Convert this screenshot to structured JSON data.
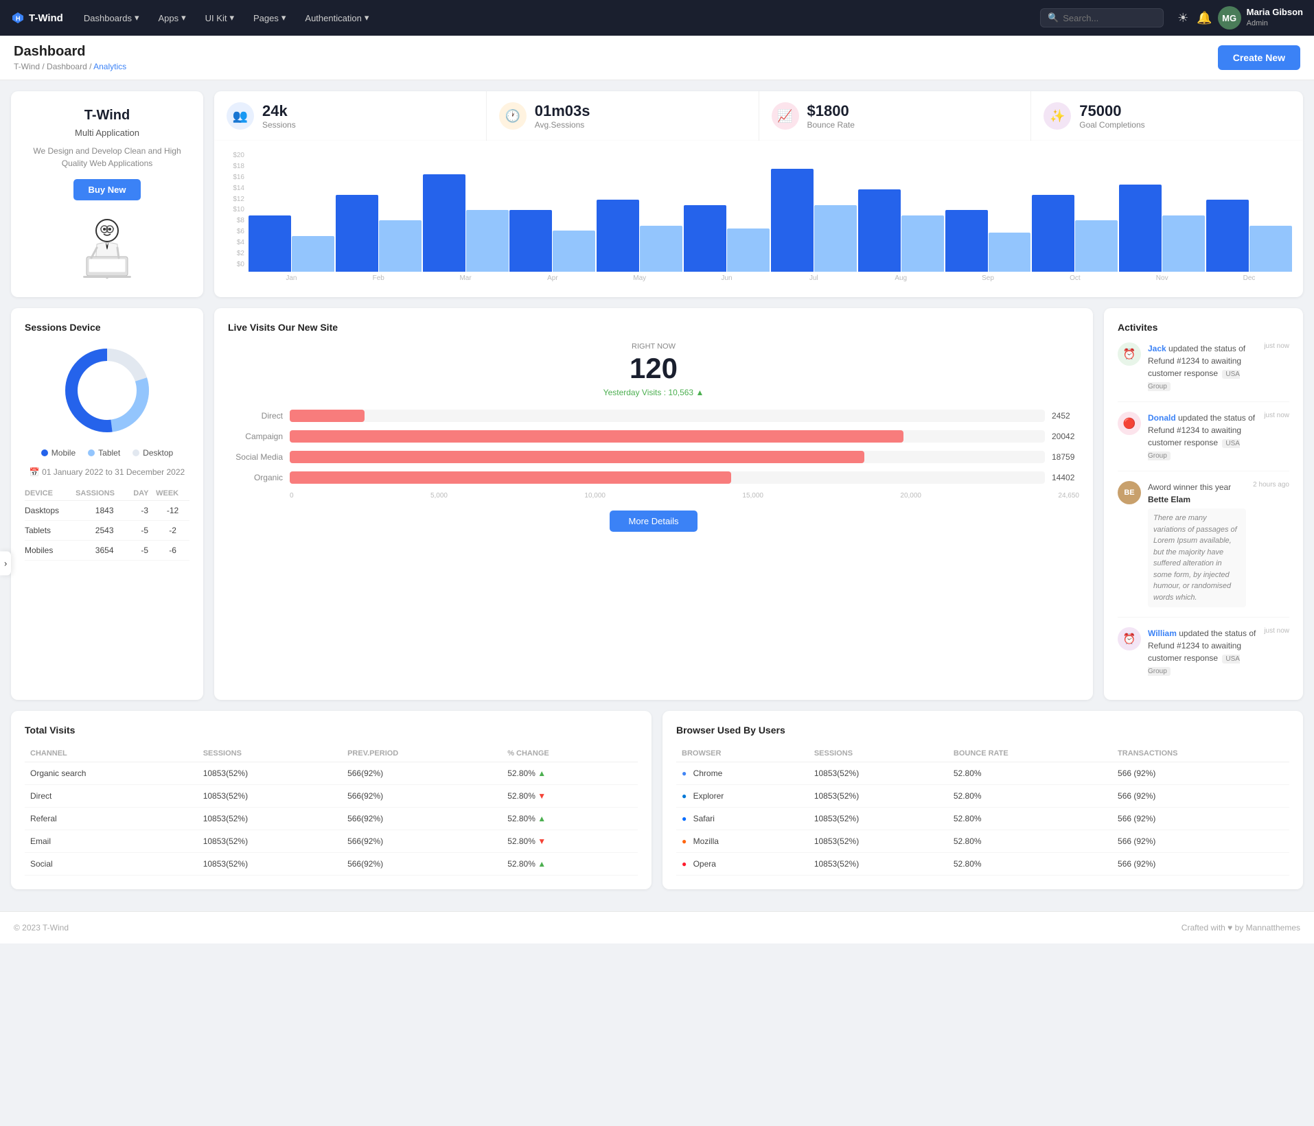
{
  "app": {
    "name": "T-Wind",
    "logo_symbol": "H"
  },
  "navbar": {
    "logo": "T-Wind",
    "dashboards_label": "Dashboards",
    "apps_label": "Apps",
    "ui_kit_label": "UI Kit",
    "pages_label": "Pages",
    "authentication_label": "Authentication",
    "search_placeholder": "Search...",
    "user_name": "Maria Gibson",
    "user_role": "Admin",
    "user_initials": "MG"
  },
  "header": {
    "title": "Dashboard",
    "breadcrumb": [
      "T-Wind",
      "Dashboard",
      "Analytics"
    ],
    "create_button": "Create New"
  },
  "promo": {
    "title": "T-Wind",
    "subtitle": "Multi Application",
    "desc": "We Design and Develop Clean and High Quality Web Applications",
    "button": "Buy New"
  },
  "stats": [
    {
      "icon": "👥",
      "value": "24k",
      "label": "Sessions",
      "icon_color": "blue"
    },
    {
      "icon": "🕐",
      "value": "01m03s",
      "label": "Avg.Sessions",
      "icon_color": "orange"
    },
    {
      "icon": "📈",
      "value": "$1800",
      "label": "Bounce Rate",
      "icon_color": "red"
    },
    {
      "icon": "✨",
      "value": "75000",
      "label": "Goal Completions",
      "icon_color": "purple"
    }
  ],
  "chart": {
    "y_labels": [
      "$20",
      "$18",
      "$16",
      "$14",
      "$12",
      "$10",
      "$8",
      "$6",
      "$4",
      "$2",
      "$0"
    ],
    "x_labels": [
      "Jan",
      "Feb",
      "Mar",
      "Apr",
      "May",
      "Jun",
      "Jul",
      "Aug",
      "Sep",
      "Oct",
      "Nov",
      "Dec"
    ],
    "bars": [
      {
        "dark": 55,
        "light": 35
      },
      {
        "dark": 75,
        "light": 50
      },
      {
        "dark": 95,
        "light": 60
      },
      {
        "dark": 60,
        "light": 40
      },
      {
        "dark": 70,
        "light": 45
      },
      {
        "dark": 65,
        "light": 42
      },
      {
        "dark": 100,
        "light": 65
      },
      {
        "dark": 80,
        "light": 55
      },
      {
        "dark": 60,
        "light": 38
      },
      {
        "dark": 75,
        "light": 50
      },
      {
        "dark": 85,
        "light": 55
      },
      {
        "dark": 70,
        "light": 45
      }
    ]
  },
  "sessions_device": {
    "title": "Sessions Device",
    "legend": [
      {
        "label": "Mobile",
        "color": "#2563eb"
      },
      {
        "label": "Tablet",
        "color": "#93c5fd"
      },
      {
        "label": "Desktop",
        "color": "#e2e8f0"
      }
    ],
    "date_range": "01 January 2022 to 31 December 2022",
    "table_headers": [
      "DEVICE",
      "SASSIONS",
      "DAY",
      "WEEK"
    ],
    "rows": [
      {
        "device": "Dasktops",
        "sessions": "1843",
        "day": "-3",
        "week": "-12"
      },
      {
        "device": "Tablets",
        "sessions": "2543",
        "day": "-5",
        "week": "-2"
      },
      {
        "device": "Mobiles",
        "sessions": "3654",
        "day": "-5",
        "week": "-6"
      }
    ],
    "donut": {
      "mobile_pct": 52,
      "tablet_pct": 28,
      "desktop_pct": 20
    }
  },
  "live_visits": {
    "title": "Live Visits Our New Site",
    "right_now_label": "RIGHT NOW",
    "count": "120",
    "yesterday_label": "Yesterday Visits : 10,563",
    "bars": [
      {
        "label": "Direct",
        "value": 2452,
        "max": 24650
      },
      {
        "label": "Campaign",
        "value": 20042,
        "max": 24650
      },
      {
        "label": "Social Media",
        "value": 18759,
        "max": 24650
      },
      {
        "label": "Organic",
        "value": 14402,
        "max": 24650
      }
    ],
    "x_axis": [
      "0",
      "5,000",
      "10,000",
      "15,000",
      "20,000",
      "24,650"
    ],
    "more_button": "More Details"
  },
  "activities": {
    "title": "Activites",
    "items": [
      {
        "icon_type": "green",
        "icon": "🕐",
        "user": "Jack",
        "text": " updated the status of Refund #1234 to awaiting customer response",
        "tag": "USA Group",
        "time": "just now"
      },
      {
        "icon_type": "pink",
        "icon": "🔴",
        "user": "Donald",
        "text": " updated the status of Refund #1234 to awaiting customer response",
        "tag": "USA Group",
        "time": "just now"
      },
      {
        "icon_type": "avatar",
        "icon": "BE",
        "user": "Bette Elam",
        "text": "Aword winner this year",
        "quote": "There are many variations of passages of Lorem Ipsum available, but the majority have suffered alteration in some form, by injected humour, or randomised words which.",
        "time": "2 hours ago"
      },
      {
        "icon_type": "purple2",
        "icon": "🕐",
        "user": "William",
        "text": " updated the status of Refund #1234 to awaiting customer response",
        "tag": "USA Group",
        "time": "just now"
      }
    ]
  },
  "total_visits": {
    "title": "Total Visits",
    "headers": [
      "CHANNEL",
      "SESSIONS",
      "PREV.PERIOD",
      "% CHANGE"
    ],
    "rows": [
      {
        "channel": "Organic search",
        "sessions": "10853(52%)",
        "prev": "566(92%)",
        "change": "52.80%",
        "trend": "up"
      },
      {
        "channel": "Direct",
        "sessions": "10853(52%)",
        "prev": "566(92%)",
        "change": "52.80%",
        "trend": "down"
      },
      {
        "channel": "Referal",
        "sessions": "10853(52%)",
        "prev": "566(92%)",
        "change": "52.80%",
        "trend": "up"
      },
      {
        "channel": "Email",
        "sessions": "10853(52%)",
        "prev": "566(92%)",
        "change": "52.80%",
        "trend": "down"
      },
      {
        "channel": "Social",
        "sessions": "10853(52%)",
        "prev": "566(92%)",
        "change": "52.80%",
        "trend": "up"
      }
    ]
  },
  "browser_users": {
    "title": "Browser Used By Users",
    "headers": [
      "BROWSER",
      "SESSIONS",
      "BOUNCE RATE",
      "TRANSACTIONS"
    ],
    "rows": [
      {
        "name": "Chrome",
        "icon": "🌐",
        "color": "#4285F4",
        "sessions": "10853(52%)",
        "bounce": "52.80%",
        "trans": "566 (92%)"
      },
      {
        "name": "Explorer",
        "icon": "🌐",
        "color": "#0078D7",
        "sessions": "10853(52%)",
        "bounce": "52.80%",
        "trans": "566 (92%)"
      },
      {
        "name": "Safari",
        "icon": "🧭",
        "color": "#006CFF",
        "sessions": "10853(52%)",
        "bounce": "52.80%",
        "trans": "566 (92%)"
      },
      {
        "name": "Mozilla",
        "icon": "🦊",
        "color": "#FF6611",
        "sessions": "10853(52%)",
        "bounce": "52.80%",
        "trans": "566 (92%)"
      },
      {
        "name": "Opera",
        "icon": "🅾",
        "color": "#FF1B2D",
        "sessions": "10853(52%)",
        "bounce": "52.80%",
        "trans": "566 (92%)"
      }
    ]
  },
  "footer": {
    "left": "© 2023 T-Wind",
    "right": "Crafted with ♥ by Mannatthemes"
  }
}
